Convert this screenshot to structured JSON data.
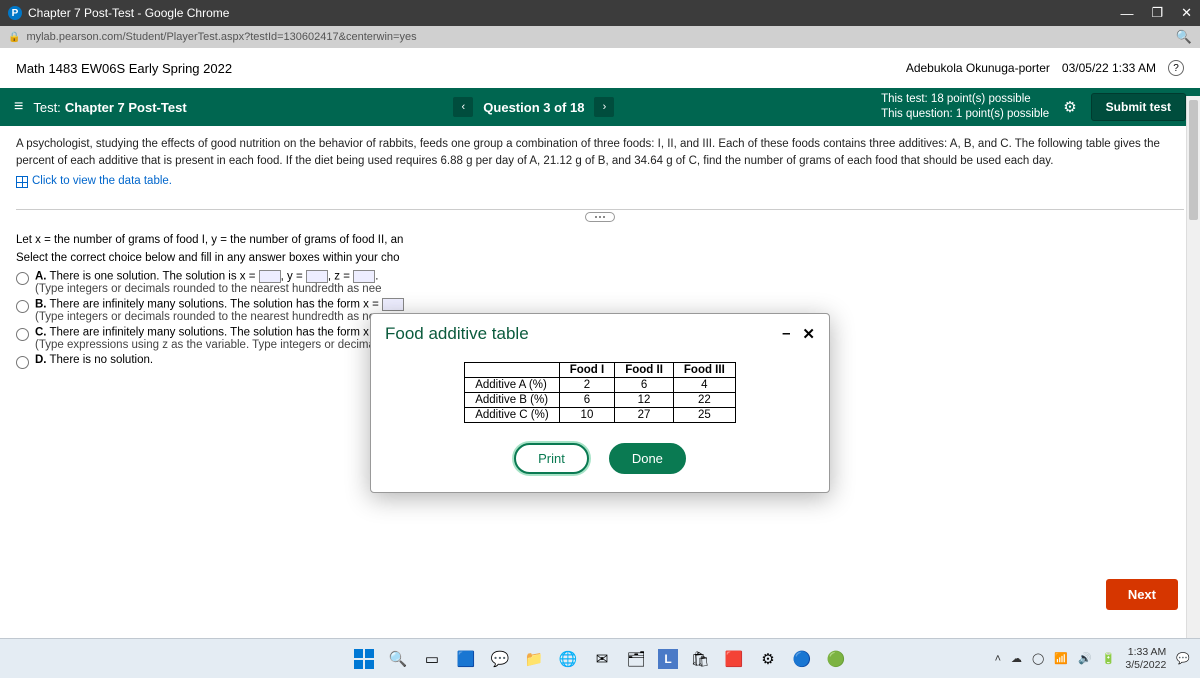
{
  "chrome": {
    "title": "Chapter 7 Post-Test - Google Chrome",
    "url": "mylab.pearson.com/Student/PlayerTest.aspx?testId=130602417&centerwin=yes"
  },
  "course": {
    "name": "Math 1483 EW06S Early Spring 2022",
    "user": "Adebukola Okunuga-porter",
    "datetime": "03/05/22 1:33 AM"
  },
  "test": {
    "label": "Test:",
    "name": "Chapter 7 Post-Test",
    "qnav": "Question 3 of 18",
    "status1": "This test: 18 point(s) possible",
    "status2": "This question: 1 point(s) possible",
    "submit": "Submit test"
  },
  "problem": {
    "text": "A psychologist, studying the effects of good nutrition on the behavior of rabbits, feeds one group a combination of three foods: I, II, and III. Each of these foods contains three additives: A, B, and C. The following table gives the percent of each additive that is present in each food. If the diet being used requires 6.88 g per day of A, 21.12 g of B, and 34.64 g of C, find the number of grams of each food that should be used each day.",
    "link": "Click to view the data table."
  },
  "work": {
    "intro1": "Let x = the number of grams of food I, y = the number of grams of food II, an",
    "intro2": "Select the correct choice below and fill in any answer boxes within your cho",
    "a1": "There is one solution. The solution is x =",
    "a2": ", y =",
    "a3": ", z =",
    "asub": "(Type integers or decimals rounded to the nearest hundredth as nee",
    "b1": "There are infinitely many solutions. The solution has the form x =",
    "bsub": "(Type integers or decimals rounded to the nearest hundredth as nee",
    "c1": "There are infinitely many solutions. The solution has the form x =",
    "csub": "(Type expressions using z as the variable. Type integers or decimal",
    "d": "There is no solution."
  },
  "modal": {
    "title": "Food additive table",
    "headers": [
      "",
      "Food I",
      "Food II",
      "Food III"
    ],
    "rows": [
      [
        "Additive A (%)",
        "2",
        "6",
        "4"
      ],
      [
        "Additive B (%)",
        "6",
        "12",
        "22"
      ],
      [
        "Additive C (%)",
        "10",
        "27",
        "25"
      ]
    ],
    "print": "Print",
    "done": "Done"
  },
  "next": "Next",
  "tray": {
    "time": "1:33 AM",
    "date": "3/5/2022"
  }
}
